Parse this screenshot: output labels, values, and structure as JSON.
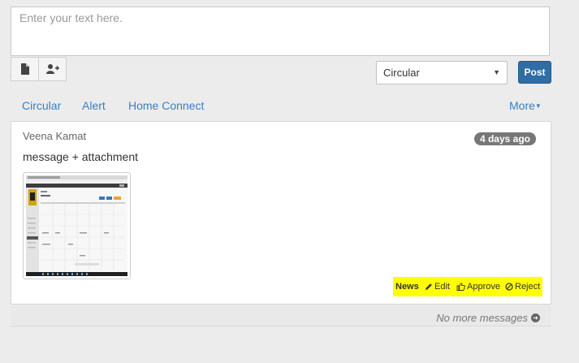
{
  "composer": {
    "placeholder": "Enter your text here."
  },
  "toolbar": {
    "file_icon": "file-icon",
    "adduser_icon": "add-user-icon",
    "category_selected": "Circular",
    "post_label": "Post"
  },
  "tabs": [
    {
      "label": "Circular"
    },
    {
      "label": "Alert"
    },
    {
      "label": "Home Connect"
    }
  ],
  "more_label": "More",
  "post": {
    "author": "Veena Kamat",
    "time_ago": "4 days ago",
    "message": "message + attachment",
    "attachment_icon": "screenshot-thumbnail",
    "actions": {
      "news": "News",
      "edit": "Edit",
      "approve": "Approve",
      "reject": "Reject"
    }
  },
  "footer": {
    "no_more": "No more messages"
  },
  "colors": {
    "accent": "#3a7ebf",
    "post_button": "#2f6da5",
    "highlight": "#ffff00",
    "badge": "#777777"
  }
}
